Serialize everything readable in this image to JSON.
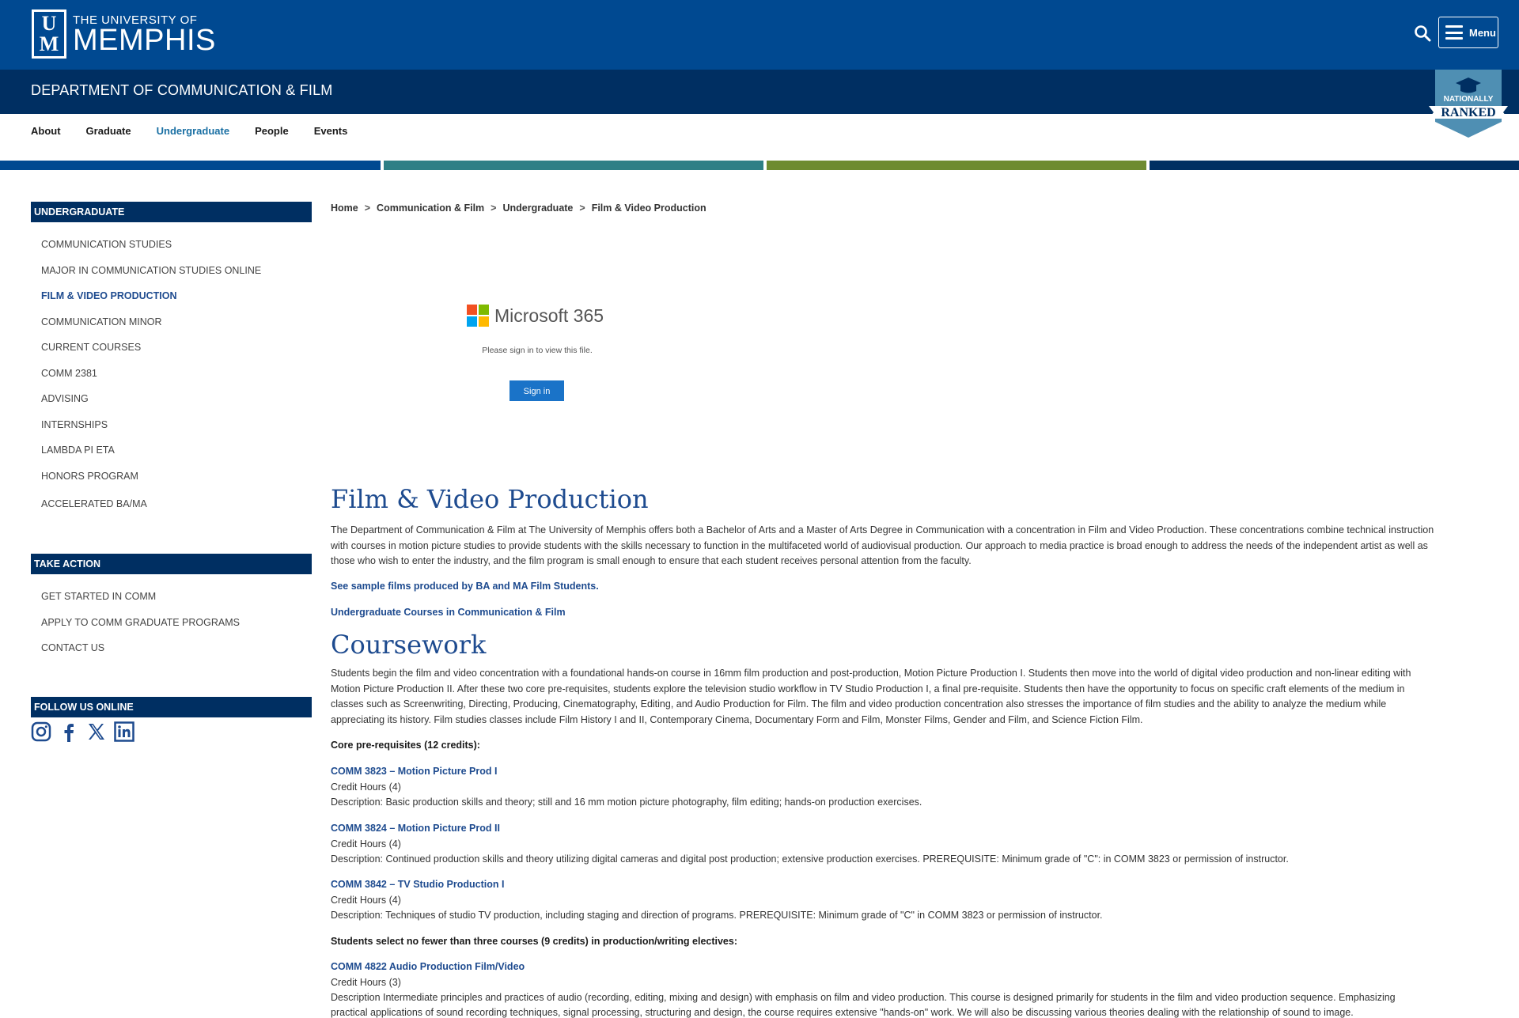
{
  "header": {
    "logo_small": "THE UNIVERSITY OF",
    "logo_big": "MEMPHIS",
    "menu_label": "Menu",
    "department": "DEPARTMENT OF COMMUNICATION & FILM",
    "badge_top": "NATIONALLY",
    "badge_bottom": "RANKED"
  },
  "subnav": [
    "About",
    "Graduate",
    "Undergraduate",
    "People",
    "Events"
  ],
  "colors": {
    "primary": "#004991",
    "dark": "#002f62",
    "bar_teal": "#2e7f86",
    "bar_olive": "#6e8b30",
    "link": "#1e4b8f"
  },
  "sidebar": {
    "undergrad_title": "UNDERGRADUATE",
    "undergrad_items": [
      "COMMUNICATION STUDIES",
      "MAJOR IN COMMUNICATION STUDIES ONLINE",
      "FILM & VIDEO PRODUCTION",
      "COMMUNICATION MINOR",
      "CURRENT COURSES",
      "COMM 2381",
      "ADVISING",
      "INTERNSHIPS",
      "LAMBDA PI ETA",
      "HONORS PROGRAM",
      "ACCELERATED BA/MA"
    ],
    "action_title": "TAKE ACTION",
    "action_items": [
      "GET STARTED IN COMM",
      "APPLY TO COMM GRADUATE PROGRAMS",
      "CONTACT US"
    ],
    "follow_title": "FOLLOW US ONLINE"
  },
  "breadcrumb": [
    "Home",
    "Communication & Film",
    "Undergraduate",
    "Film & Video Production"
  ],
  "embed": {
    "brand": "Microsoft 365",
    "message": "Please sign in to view this file.",
    "signin": "Sign in"
  },
  "main": {
    "title": "Film & Video Production",
    "intro": "The Department of Communication & Film at The University of Memphis offers both a Bachelor of Arts and a Master of Arts Degree in Communication with a concentration in Film and Video Production. These concentrations combine technical instruction with courses in motion picture studies to provide students with the skills necessary to function in the multifaceted world of audiovisual production. Our approach to media practice is broad enough to address the needs of the independent artist as well as those who wish to enter the industry, and the film program is small enough to ensure that each student receives personal attention from the faculty.",
    "link1": "See sample films produced by BA and MA Film Students.",
    "link2": "Undergraduate Courses in Communication & Film",
    "coursework_title": "Coursework",
    "coursework_text": "Students begin the film and video concentration with a foundational hands-on course in 16mm film production and post-production, Motion Picture Production I. Students then move into the world of digital video production and non-linear editing with Motion Picture Production II. After these two core pre-requisites, students explore the television studio workflow in TV Studio Production I, a final pre-requisite. Students then have the opportunity to focus on specific craft elements of the medium in classes such as Screenwriting, Directing, Producing, Cinematography, Editing, and Audio Production for Film. The film and video production concentration also stresses the importance of film studies and the ability to analyze the medium while appreciating its history. Film studies classes include Film History I and II, Contemporary Cinema, Documentary Form and Film, Monster Films, Gender and Film, and Science Fiction Film.",
    "core_label": "Core pre-requisites (12 credits):",
    "courses": [
      {
        "title": "COMM 3823 – Motion Picture Prod I",
        "hours": "Credit Hours (4)",
        "desc": "Description: Basic production skills and theory; still and 16 mm motion picture photography, film editing; hands-on production exercises."
      },
      {
        "title": "COMM 3824 – Motion Picture Prod II",
        "hours": "Credit Hours (4)",
        "desc": "Description: Continued production skills and theory utilizing digital cameras and digital post production; extensive production exercises. PREREQUISITE: Minimum grade of \"C\": in COMM 3823 or permission of instructor."
      },
      {
        "title": "COMM 3842 – TV Studio Production I",
        "hours": "Credit Hours (4)",
        "desc": "Description: Techniques of studio TV production, including staging and direction of programs. PREREQUISITE: Minimum grade of \"C\" in COMM 3823 or permission of instructor."
      }
    ],
    "elective_label": "Students select no fewer than three courses (9 credits) in production/writing electives:",
    "elective": {
      "title": "COMM 4822 Audio Production Film/Video",
      "hours": "Credit Hours (3)",
      "desc": "Description Intermediate principles and practices of audio (recording, editing, mixing and design) with emphasis on film and video production. This course is designed primarily for students in the film and video production sequence. Emphasizing",
      "desc2": "practical applications of sound recording techniques, signal processing, structuring and design, the course requires extensive \"hands-on\" work. We will also be discussing various theories dealing with the relationship of sound to image."
    }
  }
}
